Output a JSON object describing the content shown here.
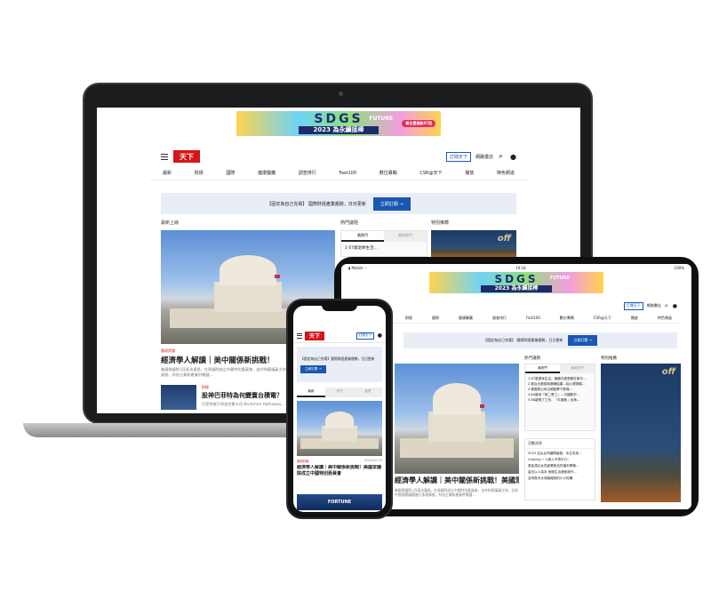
{
  "site": {
    "logo_text": "天下",
    "banner_title": "SDGS",
    "banner_subtitle": "2023 為永續接棒",
    "banner_future": "FUTURE",
    "banner_tag": "報名看最新87回",
    "subscribe": "訂閱天下",
    "store": "網路書店",
    "nav": [
      "最新",
      "財經",
      "國際",
      "健康醫藥",
      "調查排行",
      "Fast100",
      "數位專輯",
      "CSR@天下",
      "播放",
      "特色頻道"
    ],
    "promo_text": "【固定為自己充電】 國際財經產業趨勢，日日更新",
    "promo_text_mobile": "【固定為自己充電】國際財經產業趨勢，日日更新",
    "promo_button": "立即訂閱 →",
    "latest_label": "最新上線",
    "hot_label": "熱門議題",
    "special_label": "特別推薦",
    "tabs": [
      "最熱門",
      "最新熱門",
      "推薦熱門"
    ],
    "tabs_mobile": [
      "最新",
      "熱門",
      "推薦"
    ],
    "hot_item_1": "1 67歲退休生活…",
    "hot_items_tablet": [
      "1 67歲退休生活，機器已經長期在家中…",
      "2 政治大數據與選舉結果…從心理測驗…",
      "3 壽壽險公司出現股票下跌與…",
      "4 64歲身「就二是三」…中國股市…",
      "5 88歲想了工作，「平度散」出海…"
    ],
    "activity_label": "活動消息",
    "activity_items": [
      "2023 亞太台灣國際論壇，永生未來…",
      "Cooking • 人與人不再平行！",
      "原民頂尖女性創業新品的福利策略…",
      "金石以人為本 首席生活藝術新作…",
      "全球首次大熊貓報到的小小知識"
    ],
    "article_tag": "重磅評論",
    "article_headline": "經濟學人解讀｜美中關係新挑戰！",
    "article_headline_long": "經濟學人解讀｜美中關係新挑戰！美國眾議…",
    "article_headline_mobile": "經濟學人解讀｜美中關係新挑戰！美國眾議院成立中國特別委員會",
    "article_snippet": "美國眾議院1月表決通過，在眾議院成立中國特別委員會，由共和黨議員主持，針對中國相關議題進行多項調查，科技企業和產業供應鏈…",
    "article_date": "2023-02-19",
    "second_tag": "財經",
    "second_headline": "股神巴菲特為何變賣台積電？",
    "second_snippet": "巴菲特旗下的波克夏公司 Berkshire Hathaway…",
    "special_mark": "off",
    "mobile_footer_text": "FORTUNE",
    "status_time": "10:18",
    "status_battery": "100%"
  },
  "colors": {
    "brand_red": "#d7141a",
    "accent_blue": "#1a57b3"
  }
}
